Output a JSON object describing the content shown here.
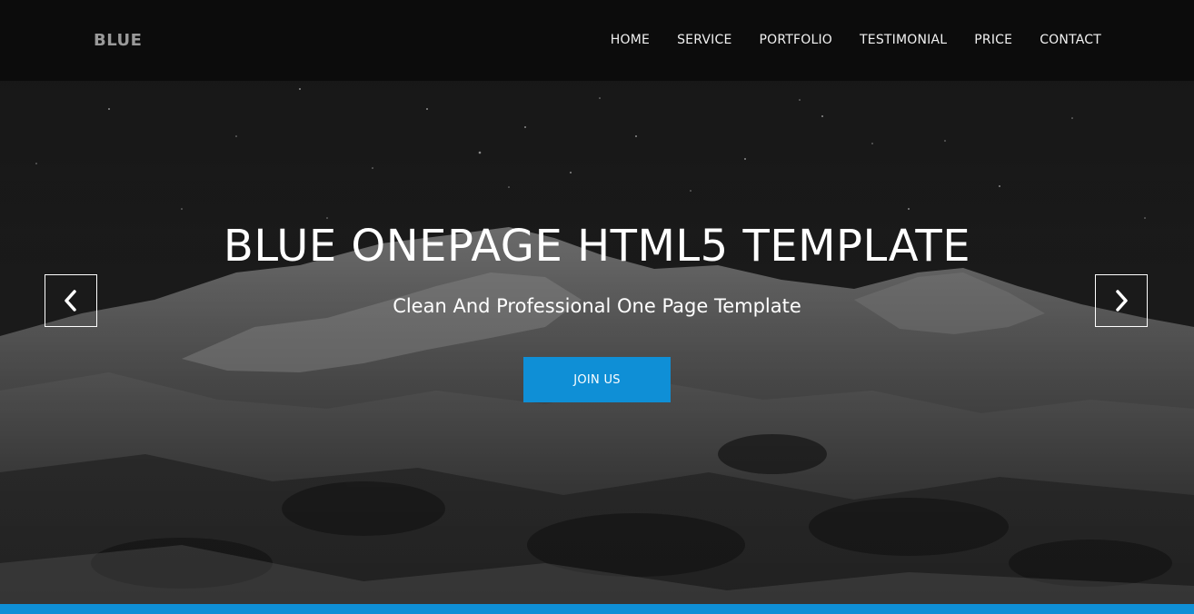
{
  "navbar": {
    "brand": "BLUE",
    "items": [
      {
        "label": "HOME"
      },
      {
        "label": "SERVICE"
      },
      {
        "label": "PORTFOLIO"
      },
      {
        "label": "TESTIMONIAL"
      },
      {
        "label": "PRICE"
      },
      {
        "label": "CONTACT"
      }
    ]
  },
  "hero": {
    "title": "BLUE ONEPAGE HTML5 TEMPLATE",
    "subtitle": "Clean And Professional One Page Template",
    "cta_label": "JOIN US",
    "prev_icon": "chevron-left-icon",
    "next_icon": "chevron-right-icon",
    "background": "night-snowy-mountain-photo"
  },
  "colors": {
    "accent": "#0f8fd6",
    "nav_bg": "#0b0b0b",
    "text": "#ffffff",
    "brand": "#9a9a9a"
  }
}
